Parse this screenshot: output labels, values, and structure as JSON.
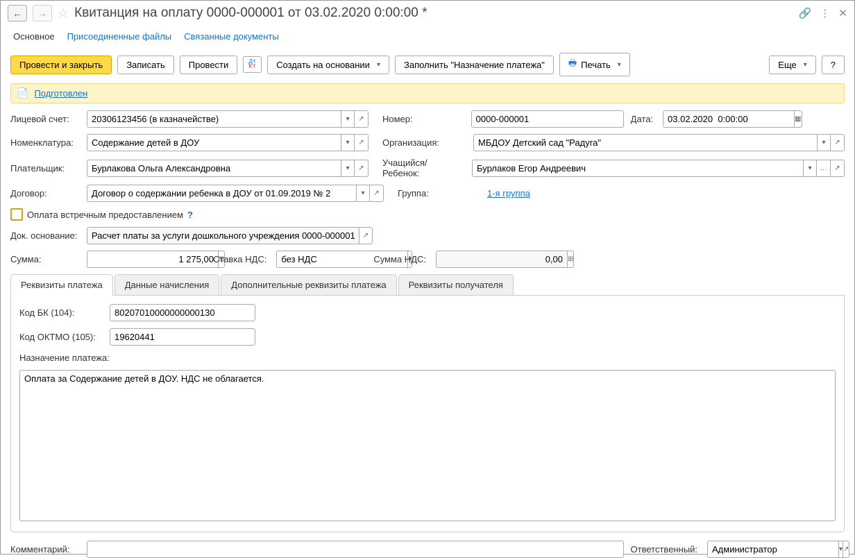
{
  "title": "Квитанция на оплату 0000-000001 от 03.02.2020 0:00:00 *",
  "tabs": {
    "main": "Основное",
    "files": "Присоединенные файлы",
    "linked": "Связанные документы"
  },
  "toolbar": {
    "post_close": "Провести и закрыть",
    "save": "Записать",
    "post": "Провести",
    "create_based": "Создать на основании",
    "fill_purpose": "Заполнить \"Назначение платежа\"",
    "print": "Печать",
    "more": "Еще",
    "help": "?"
  },
  "status": "Подготовлен",
  "labels": {
    "account": "Лицевой счет:",
    "number": "Номер:",
    "date": "Дата:",
    "nomenclature": "Номенклатура:",
    "org": "Организация:",
    "payer": "Плательщик:",
    "student": "Учащийся/Ребенок:",
    "contract": "Договор:",
    "group": "Группа:",
    "counter_pay": "Оплата встречным предоставлением",
    "basis_doc": "Док. основание:",
    "amount": "Сумма:",
    "vat_rate": "Ставка НДС:",
    "vat_sum": "Сумма НДС:",
    "bk_code": "Код БК (104):",
    "oktmo": "Код ОКТМО (105):",
    "purpose": "Назначение платежа:",
    "comment": "Комментарий:",
    "responsible": "Ответственный:"
  },
  "values": {
    "account": "20306123456 (в казначействе)",
    "number": "0000-000001",
    "date": "03.02.2020  0:00:00",
    "nomenclature": "Содержание детей в ДОУ",
    "org": "МБДОУ Детский сад \"Радуга\"",
    "payer": "Бурлакова Ольга Александровна",
    "student": "Бурлаков Егор Андреевич",
    "contract": "Договор о содержании ребенка в ДОУ от 01.09.2019 № 2",
    "group": "1-я группа",
    "basis_doc": "Расчет платы за услуги дошкольного учреждения 0000-000001",
    "amount": "1 275,00",
    "vat_rate": "без НДС",
    "vat_sum": "0,00",
    "bk_code": "80207010000000000130",
    "oktmo": "19620441",
    "purpose": "Оплата за Содержание детей в ДОУ. НДС не облагается.",
    "responsible": "Администратор"
  },
  "subtabs": {
    "payment": "Реквизиты платежа",
    "accrual": "Данные начисления",
    "additional": "Дополнительные реквизиты платежа",
    "recipient": "Реквизиты получателя"
  }
}
